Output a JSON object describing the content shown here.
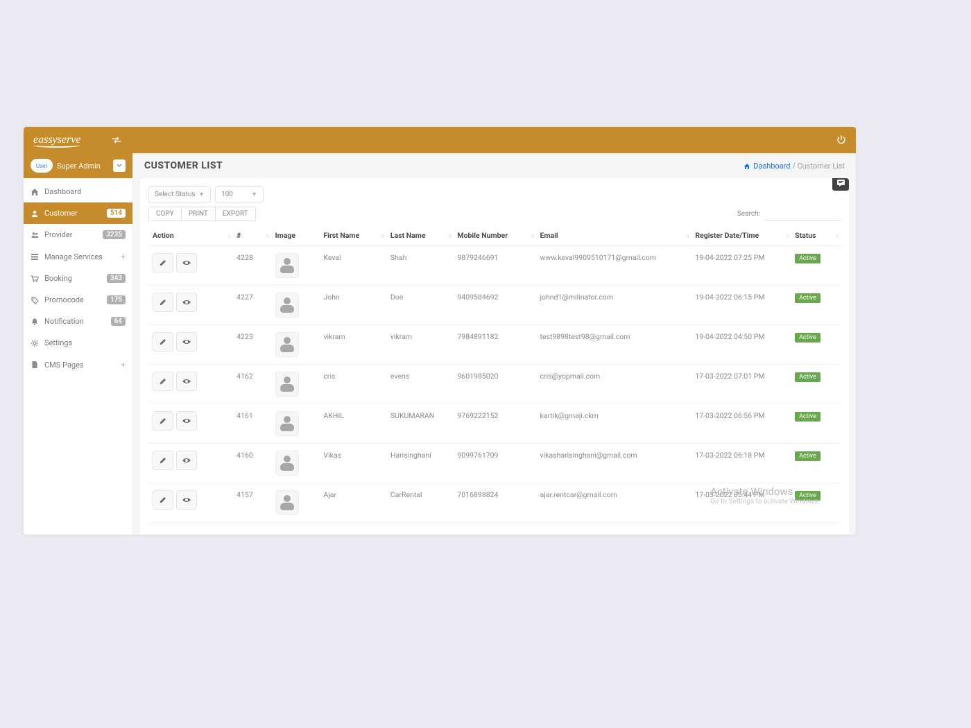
{
  "brand": "eassyserve",
  "user": {
    "thumb_text": "User",
    "role": "Super Admin"
  },
  "sidebar": {
    "items": [
      {
        "icon": "home",
        "label": "Dashboard",
        "badge": null,
        "active": false,
        "expandable": false
      },
      {
        "icon": "person",
        "label": "Customer",
        "badge": "514",
        "active": true,
        "expandable": false
      },
      {
        "icon": "group",
        "label": "Provider",
        "badge": "3235",
        "active": false,
        "expandable": false,
        "badge_gray": true
      },
      {
        "icon": "list",
        "label": "Manage Services",
        "badge": null,
        "active": false,
        "expandable": true
      },
      {
        "icon": "cart",
        "label": "Booking",
        "badge": "343",
        "active": false,
        "expandable": false,
        "badge_gray": true
      },
      {
        "icon": "tag",
        "label": "Promocode",
        "badge": "175",
        "active": false,
        "expandable": false,
        "badge_gray": true
      },
      {
        "icon": "bell",
        "label": "Notification",
        "badge": "64",
        "active": false,
        "expandable": false,
        "badge_gray": true
      },
      {
        "icon": "gear",
        "label": "Settings",
        "badge": null,
        "active": false,
        "expandable": false
      },
      {
        "icon": "file",
        "label": "CMS Pages",
        "badge": null,
        "active": false,
        "expandable": true
      }
    ]
  },
  "page": {
    "title": "CUSTOMER LIST",
    "crumb_dashboard": "Dashboard",
    "crumb_current": "Customer List"
  },
  "filters": {
    "status_label": "Select Status",
    "page_size": "100"
  },
  "toolbar": {
    "copy": "COPY",
    "print": "PRINT",
    "export": "EXPORT",
    "search_label": "Search:"
  },
  "columns": {
    "action": "Action",
    "id": "#",
    "image": "Image",
    "first_name": "First Name",
    "last_name": "Last Name",
    "mobile": "Mobile Number",
    "email": "Email",
    "register": "Register Date/Time",
    "status": "Status"
  },
  "rows": [
    {
      "id": "4228",
      "first_name": "Keval",
      "last_name": "Shah",
      "mobile": "9879246691",
      "email": "www.keval9909510171@gmail.com",
      "register": "19-04-2022 07:25 PM",
      "status": "Active"
    },
    {
      "id": "4227",
      "first_name": "John",
      "last_name": "Doe",
      "mobile": "9409584692",
      "email": "johnd1@milinator.com",
      "register": "19-04-2022 06:15 PM",
      "status": "Active"
    },
    {
      "id": "4223",
      "first_name": "vikram",
      "last_name": "vikram",
      "mobile": "7984891182",
      "email": "test9898test98@gmail.com",
      "register": "19-04-2022 04:50 PM",
      "status": "Active"
    },
    {
      "id": "4162",
      "first_name": "cris",
      "last_name": "evens",
      "mobile": "9601985020",
      "email": "cris@yopmail.com",
      "register": "17-03-2022 07:01 PM",
      "status": "Active"
    },
    {
      "id": "4161",
      "first_name": "AKHIL",
      "last_name": "SUKUMARAN",
      "mobile": "9769222152",
      "email": "kartik@gmaji.ckm",
      "register": "17-03-2022 06:56 PM",
      "status": "Active"
    },
    {
      "id": "4160",
      "first_name": "Vikas",
      "last_name": "Harisinghani",
      "mobile": "9099761709",
      "email": "vikasharisinghani@gmail.com",
      "register": "17-03-2022 06:18 PM",
      "status": "Active"
    },
    {
      "id": "4157",
      "first_name": "Ajar",
      "last_name": "CarRental",
      "mobile": "7016898824",
      "email": "ajar.rentcar@gmail.com",
      "register": "17-03-2022 05:44 PM",
      "status": "Active"
    }
  ],
  "watermark": {
    "line1": "Activate Windows",
    "line2": "Go to Settings to activate Windows."
  }
}
